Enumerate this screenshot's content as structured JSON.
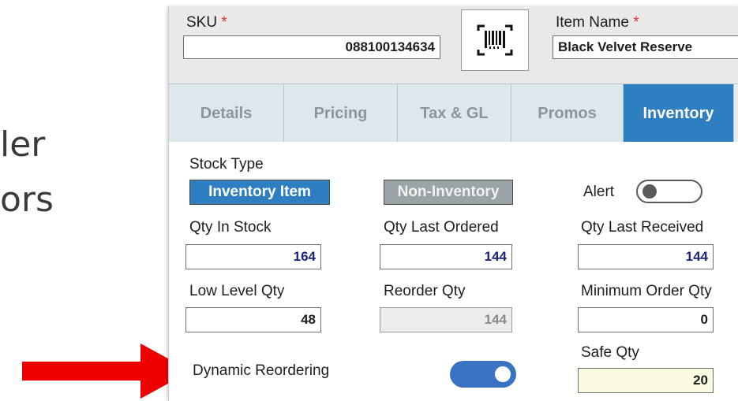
{
  "slide": {
    "line1": "ler",
    "line2": "ors"
  },
  "colors": {
    "accent": "#2e7fc1",
    "required": "#e03030",
    "arrow": "#ee0000",
    "toggle_on": "#3a72c4"
  },
  "header": {
    "sku_label": "SKU",
    "sku_value": "088100134634",
    "item_name_label": "Item Name",
    "item_name_value": "Black Velvet Reserve",
    "required_mark": "*",
    "barcode_icon": "barcode-scan-icon"
  },
  "tabs": [
    {
      "label": "Details",
      "active": false
    },
    {
      "label": "Pricing",
      "active": false
    },
    {
      "label": "Tax & GL",
      "active": false
    },
    {
      "label": "Promos",
      "active": false
    },
    {
      "label": "Inventory",
      "active": true
    }
  ],
  "inventory": {
    "stock_type_label": "Stock Type",
    "inventory_item_label": "Inventory Item",
    "non_inventory_label": "Non-Inventory",
    "alert_label": "Alert",
    "alert_on": false,
    "qty_in_stock_label": "Qty In Stock",
    "qty_in_stock": "164",
    "qty_last_ordered_label": "Qty Last Ordered",
    "qty_last_ordered": "144",
    "qty_last_received_label": "Qty Last Received",
    "qty_last_received": "144",
    "low_level_qty_label": "Low Level Qty",
    "low_level_qty": "48",
    "reorder_qty_label": "Reorder Qty",
    "reorder_qty": "144",
    "minimum_order_qty_label": "Minimum Order Qty",
    "minimum_order_qty": "0",
    "safe_qty_label": "Safe Qty",
    "safe_qty": "20",
    "dynamic_reordering_label": "Dynamic Reordering",
    "dynamic_reordering_on": true
  }
}
